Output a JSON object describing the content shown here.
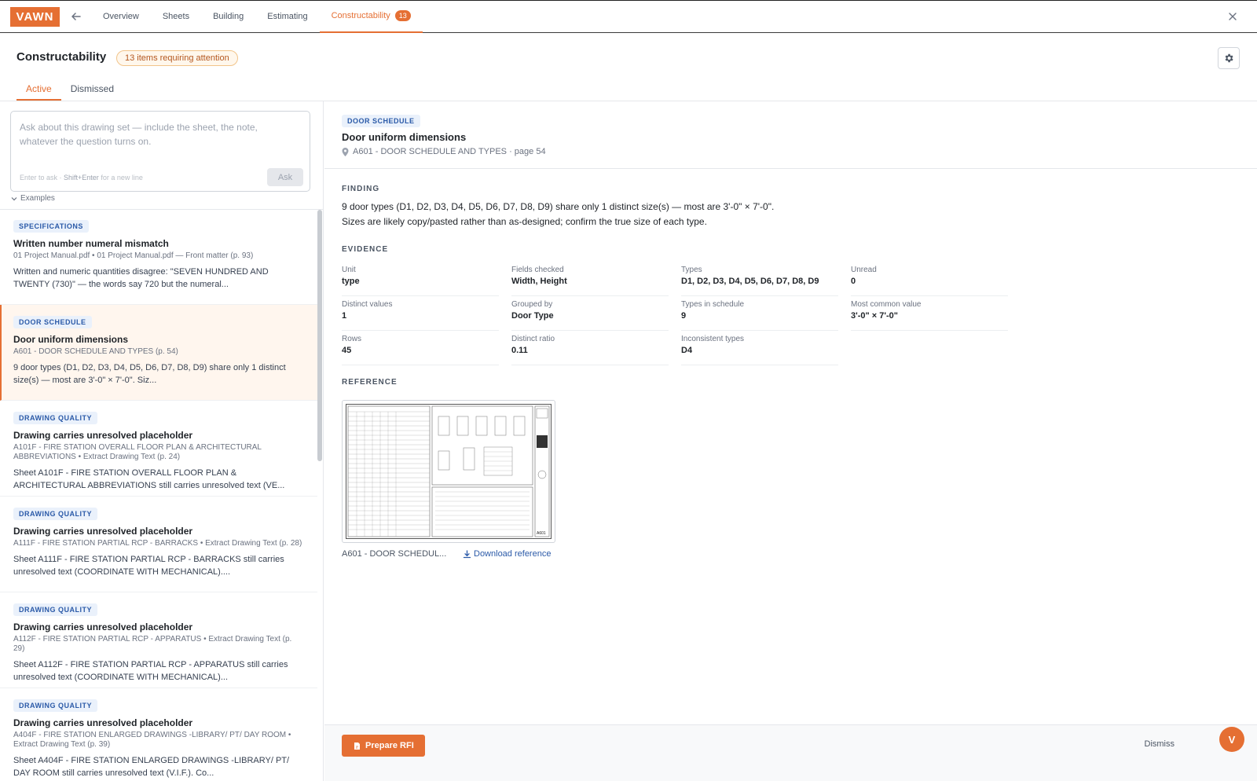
{
  "app": {
    "logo": "VAWN",
    "nav_tabs": [
      {
        "label": "Overview"
      },
      {
        "label": "Sheets"
      },
      {
        "label": "Building"
      },
      {
        "label": "Estimating"
      },
      {
        "label": "Constructability",
        "badge": "13"
      }
    ]
  },
  "header": {
    "title": "Constructability",
    "attention_badge": "13 items requiring attention",
    "tabs": [
      {
        "label": "Active"
      },
      {
        "label": "Dismissed"
      }
    ]
  },
  "ask": {
    "placeholder": "Ask about this drawing set — include the sheet, the note, whatever the question turns on.",
    "hint_prefix": "Enter to ask · ",
    "hint_key": "Shift+Enter",
    "hint_suffix": " for a new line",
    "button": "Ask",
    "examples": "Examples"
  },
  "items": [
    {
      "category": "SPECIFICATIONS",
      "title": "Written number numeral mismatch",
      "meta": "01 Project Manual.pdf • 01 Project Manual.pdf — Front matter (p. 93)",
      "desc": "Written and numeric quantities disagree: \"SEVEN HUNDRED AND TWENTY (730)\" — the words say 720 but the numeral..."
    },
    {
      "category": "DOOR SCHEDULE",
      "title": "Door uniform dimensions",
      "meta": "A601 - DOOR SCHEDULE AND TYPES (p. 54)",
      "desc": "9 door types (D1, D2, D3, D4, D5, D6, D7, D8, D9) share only 1 distinct size(s) — most are 3'-0\" × 7'-0\". Siz..."
    },
    {
      "category": "DRAWING QUALITY",
      "title": "Drawing carries unresolved placeholder",
      "meta": "A101F - FIRE STATION OVERALL FLOOR PLAN & ARCHITECTURAL ABBREVIATIONS • Extract Drawing Text (p. 24)",
      "desc": "Sheet A101F - FIRE STATION OVERALL FLOOR PLAN & ARCHITECTURAL ABBREVIATIONS still carries unresolved text (VE..."
    },
    {
      "category": "DRAWING QUALITY",
      "title": "Drawing carries unresolved placeholder",
      "meta": "A111F - FIRE STATION PARTIAL RCP - BARRACKS • Extract Drawing Text (p. 28)",
      "desc": "Sheet A111F - FIRE STATION PARTIAL RCP - BARRACKS still carries unresolved text (COORDINATE WITH MECHANICAL)...."
    },
    {
      "category": "DRAWING QUALITY",
      "title": "Drawing carries unresolved placeholder",
      "meta": "A112F - FIRE STATION PARTIAL RCP - APPARATUS • Extract Drawing Text (p. 29)",
      "desc": "Sheet A112F - FIRE STATION PARTIAL RCP - APPARATUS still carries unresolved text (COORDINATE WITH MECHANICAL)..."
    },
    {
      "category": "DRAWING QUALITY",
      "title": "Drawing carries unresolved placeholder",
      "meta": "A404F - FIRE STATION ENLARGED DRAWINGS -LIBRARY/ PT/ DAY ROOM • Extract Drawing Text (p. 39)",
      "desc": "Sheet A404F - FIRE STATION ENLARGED DRAWINGS -LIBRARY/ PT/ DAY ROOM still carries unresolved text (V.I.F.). Co..."
    }
  ],
  "detail": {
    "category": "DOOR SCHEDULE",
    "title": "Door uniform dimensions",
    "location": "A601 - DOOR SCHEDULE AND TYPES · page 54",
    "finding_label": "FINDING",
    "finding": "9 door types (D1, D2, D3, D4, D5, D6, D7, D8, D9) share only 1 distinct size(s) — most are 3'-0\" × 7'-0\". Sizes are likely copy/pasted rather than as-designed; confirm the true size of each type.",
    "evidence_label": "EVIDENCE",
    "evidence": [
      {
        "label": "Unit",
        "value": "type"
      },
      {
        "label": "Fields checked",
        "value": "Width, Height"
      },
      {
        "label": "Types",
        "value": "D1, D2, D3, D4, D5, D6, D7, D8, D9"
      },
      {
        "label": "Unread",
        "value": "0"
      },
      {
        "label": "Distinct values",
        "value": "1"
      },
      {
        "label": "Grouped by",
        "value": "Door Type"
      },
      {
        "label": "Types in schedule",
        "value": "9"
      },
      {
        "label": "Most common value",
        "value": "3'-0\" × 7'-0\""
      },
      {
        "label": "Rows",
        "value": "45"
      },
      {
        "label": "Distinct ratio",
        "value": "0.11"
      },
      {
        "label": "Inconsistent types",
        "value": "D4"
      }
    ],
    "reference_label": "REFERENCE",
    "reference_caption": "A601 - DOOR SCHEDUL...",
    "reference_download": "Download reference",
    "reference_sheet_tag": "A601"
  },
  "footer": {
    "prepare_rfi": "Prepare RFI",
    "dismiss": "Dismiss",
    "avatar": "V"
  },
  "colors": {
    "accent": "#e56f33",
    "badge_blue": "#2b5aa8"
  }
}
